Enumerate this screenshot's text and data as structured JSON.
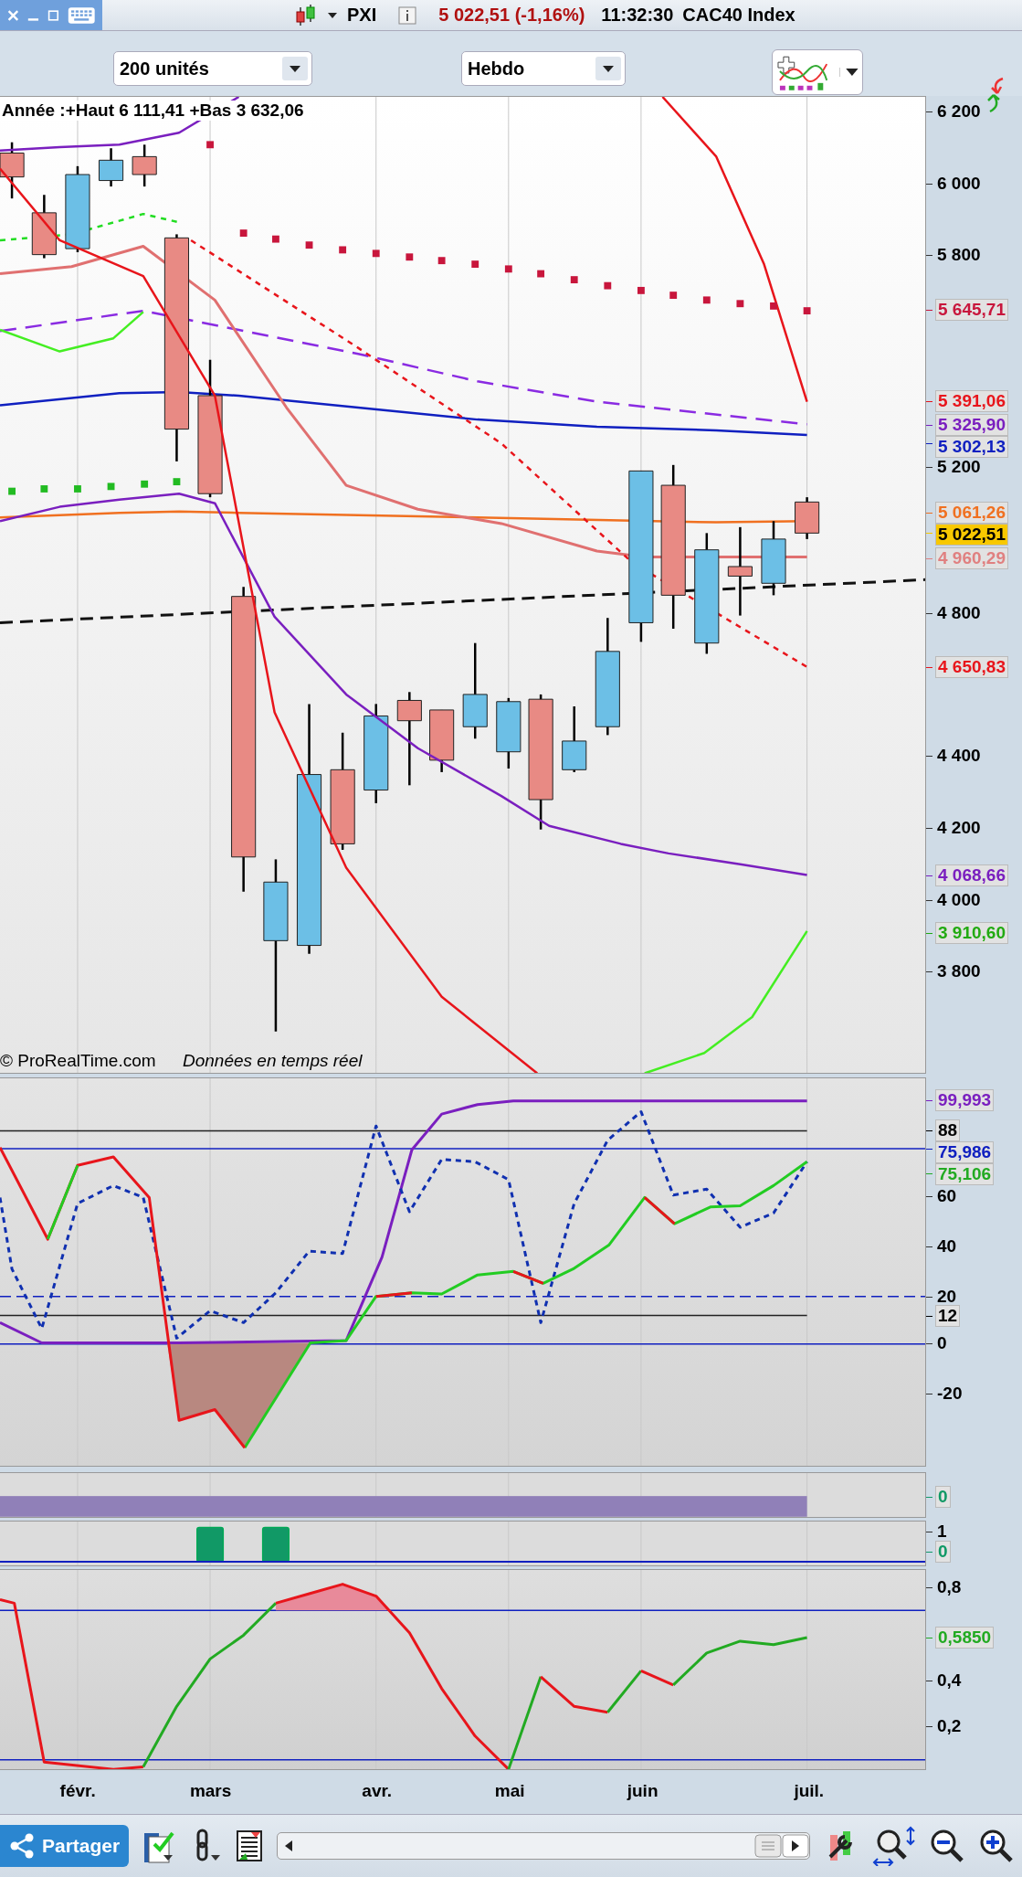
{
  "top_bar": {
    "symbol": "PXI",
    "quote": "5 022,51 (-1,16%)",
    "time": "11:32:30",
    "instrument": "CAC40 Index"
  },
  "controls": {
    "units": "200 unités",
    "period": "Hebdo"
  },
  "price_panel": {
    "legend": "Année :+Haut 6 111,41 +Bas 3 632,06",
    "copyright": "© ProRealTime.com",
    "data_note": "Données en temps réel",
    "ticks": [
      "6 200",
      "6 000",
      "5 800",
      "5 200",
      "4 800",
      "4 400",
      "4 200",
      "4 000",
      "3 800"
    ],
    "tags": [
      {
        "text": "5 645,71",
        "color": "#c8163c",
        "kind": "plain"
      },
      {
        "text": "5 391,06",
        "color": "#e8151b",
        "kind": "plain"
      },
      {
        "text": "5 325,90",
        "color": "#7a1fbf",
        "kind": "plain"
      },
      {
        "text": "5 302,13",
        "color": "#1020c0",
        "kind": "plain"
      },
      {
        "text": "5 061,26",
        "color": "#f07020",
        "kind": "plain"
      },
      {
        "text": "5 022,51",
        "color": "#f8c800",
        "kind": "current"
      },
      {
        "text": "4 960,29",
        "color": "#e08080",
        "kind": "plain"
      },
      {
        "text": "4 650,83",
        "color": "#e8151b",
        "kind": "plain"
      },
      {
        "text": "4 068,66",
        "color": "#7a1fbf",
        "kind": "plain"
      },
      {
        "text": "3 910,60",
        "color": "#22aa11",
        "kind": "plain"
      }
    ]
  },
  "oscillator_panel": {
    "ticks": [
      "60",
      "40",
      "20",
      "0",
      "-20"
    ],
    "tags": [
      {
        "text": "99,993",
        "color": "#7a1fbf",
        "kind": "plain"
      },
      {
        "text": "88",
        "color": "#000000",
        "kind": "plain"
      },
      {
        "text": "75,986",
        "color": "#1020c0",
        "kind": "plain"
      },
      {
        "text": "75,106",
        "color": "#22aa22",
        "kind": "plain"
      },
      {
        "text": "12",
        "color": "#000000",
        "kind": "plain"
      }
    ]
  },
  "signal_panel": {
    "tags": [
      {
        "text": "0",
        "color": "#119966",
        "kind": "plain"
      }
    ]
  },
  "binary_panel": {
    "ticks": [
      "1"
    ],
    "tags": [
      {
        "text": "0",
        "color": "#119966",
        "kind": "plain"
      }
    ]
  },
  "ratio_panel": {
    "ticks": [
      "0,8",
      "0,4",
      "0,2"
    ],
    "tags": [
      {
        "text": "0,5850",
        "color": "#22aa22",
        "kind": "plain"
      }
    ]
  },
  "dates": [
    "févr.",
    "mars",
    "avr.",
    "mai",
    "juin",
    "juil."
  ],
  "bottom_bar": {
    "share": "Partager"
  }
}
